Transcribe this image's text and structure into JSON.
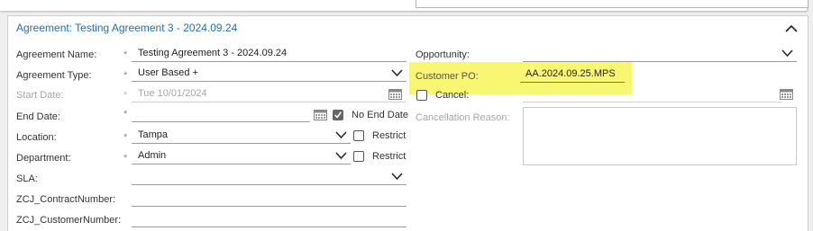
{
  "agreement": {
    "title": "Agreement: Testing Agreement 3 - 2024.09.24",
    "required_marker": "*",
    "fields": {
      "name": {
        "label": "Agreement Name:",
        "value": "Testing Agreement 3 - 2024.09.24"
      },
      "type": {
        "label": "Agreement Type:",
        "value": "User Based +"
      },
      "start_date": {
        "label": "Start Date:",
        "value": "Tue 10/01/2024"
      },
      "end_date": {
        "label": "End Date:",
        "value": "",
        "no_end_date_label": "No End Date",
        "no_end_date_checked": true
      },
      "location": {
        "label": "Location:",
        "value": "Tampa",
        "restrict_label": "Restrict"
      },
      "department": {
        "label": "Department:",
        "value": "Admin",
        "restrict_label": "Restrict"
      },
      "sla": {
        "label": "SLA:",
        "value": ""
      },
      "contract_number": {
        "label": "ZCJ_ContractNumber:",
        "value": ""
      },
      "customer_number": {
        "label": "ZCJ_CustomerNumber:",
        "value": ""
      },
      "opportunity": {
        "label": "Opportunity:",
        "value": ""
      },
      "customer_po": {
        "label": "Customer PO:",
        "value": "AA.2024.09.25.MPS"
      },
      "cancel": {
        "label": "Cancel:",
        "checked": false
      },
      "cancellation_reason": {
        "label": "Cancellation Reason:",
        "value": ""
      }
    }
  },
  "colors": {
    "title": "#1f6fb8",
    "highlight": "#f9f772"
  },
  "icons": [
    "chevron-up-icon",
    "chevron-down-icon",
    "calendar-icon",
    "checkbox-icon"
  ]
}
